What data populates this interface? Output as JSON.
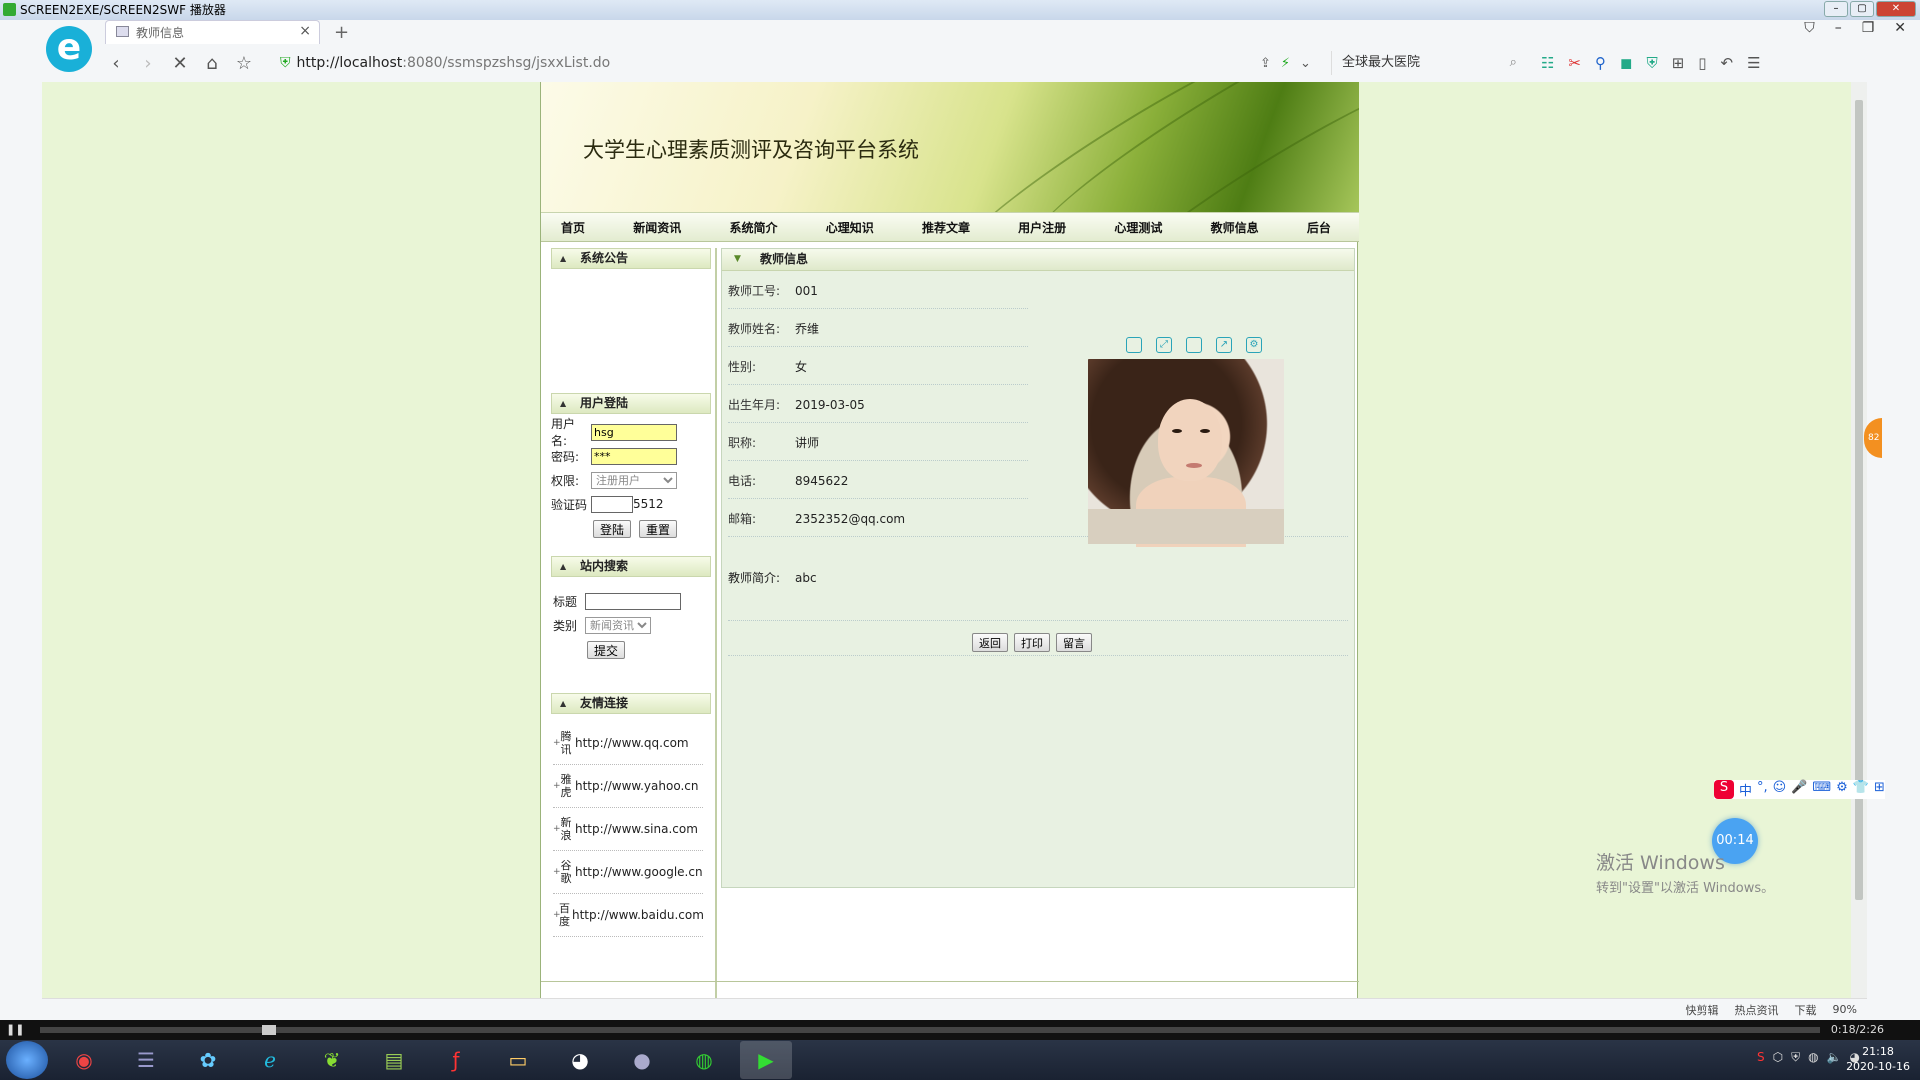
{
  "player": {
    "title": "SCREEN2EXE/SCREEN2SWF 播放器",
    "time": "0:18/2:26"
  },
  "browser": {
    "tab_title": "教师信息",
    "url_host": "http://localhost",
    "url_rest": ":8080/ssmspzshsg/jsxxList.do",
    "search_text": "全球最大医院",
    "status_items": [
      "快剪辑",
      "热点资讯",
      "下载",
      "90%"
    ]
  },
  "site": {
    "title": "大学生心理素质测评及咨询平台系统",
    "nav": [
      "首页",
      "新闻资讯",
      "系统简介",
      "心理知识",
      "推荐文章",
      "用户注册",
      "心理测试",
      "教师信息",
      "后台"
    ]
  },
  "sidebar": {
    "notice_title": "系统公告",
    "login_title": "用户登陆",
    "username_label": "用户名:",
    "username_value": "hsg",
    "password_label": "密码:",
    "password_value": "***",
    "role_label": "权限:",
    "role_value": "注册用户",
    "captcha_label": "验证码",
    "captcha_code": "5512",
    "login_btn": "登陆",
    "reset_btn": "重置",
    "search_title": "站内搜索",
    "search_title_label": "标题",
    "search_cat_label": "类别",
    "search_cat_value": "新闻资讯",
    "search_submit": "提交",
    "links_title": "友情连接",
    "links": [
      {
        "name": "腾讯",
        "url": "http://www.qq.com"
      },
      {
        "name": "雅虎",
        "url": "http://www.yahoo.cn"
      },
      {
        "name": "新浪",
        "url": "http://www.sina.com"
      },
      {
        "name": "谷歌",
        "url": "http://www.google.cn"
      },
      {
        "name": "百度",
        "url": "http://www.baidu.com"
      }
    ]
  },
  "teacher": {
    "section_title": "教师信息",
    "fields": [
      {
        "label": "教师工号:",
        "value": "001"
      },
      {
        "label": "教师姓名:",
        "value": "乔维"
      },
      {
        "label": "性别:",
        "value": "女"
      },
      {
        "label": "出生年月:",
        "value": "2019-03-05"
      },
      {
        "label": "职称:",
        "value": "讲师"
      },
      {
        "label": "电话:",
        "value": "8945622"
      },
      {
        "label": "邮箱:",
        "value": "2352352@qq.com"
      }
    ],
    "intro_label": "教师简介:",
    "intro_value": "abc",
    "buttons": {
      "back": "返回",
      "print": "打印",
      "message": "留言"
    }
  },
  "overlay": {
    "activate_title": "激活 Windows",
    "activate_sub": "转到\"设置\"以激活 Windows。",
    "timer": "00:14",
    "side_badge": "82"
  },
  "taskbar": {
    "clock_time": "21:18",
    "clock_date": "2020-10-16"
  }
}
